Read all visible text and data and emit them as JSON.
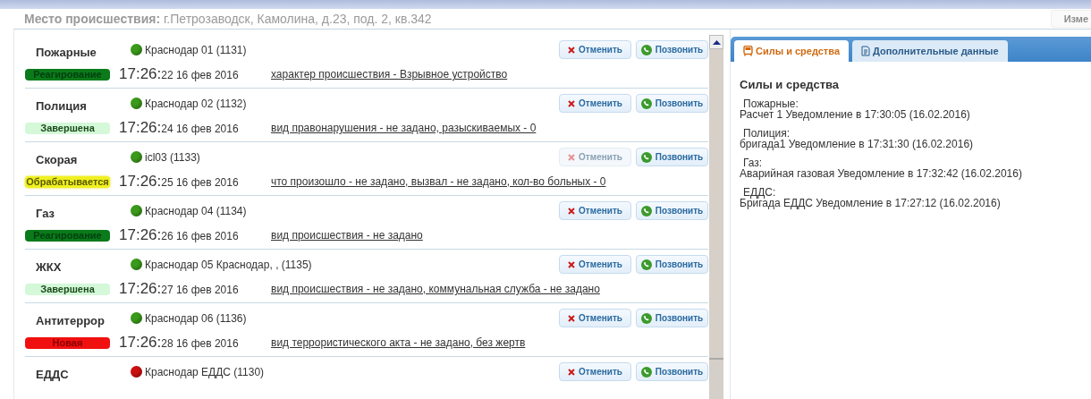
{
  "location": {
    "label": "Место происшествия:",
    "value": "г.Петрозаводск, Камолина, д.23, под. 2, кв.342"
  },
  "top_button": "Изме",
  "incidents": [
    {
      "service": "Пожарные",
      "unit": "Краснодар 01 (1131)",
      "dot": {
        "color": "#3a9a1a"
      },
      "status": {
        "kind": "reacting",
        "label": "Реагирование"
      },
      "time": "17:26:",
      "seconds_date": "22 16 фев 2016",
      "description": "характер происшествия - Взрывное устройство",
      "cancel": {
        "label": "Отменить",
        "disabled": false
      },
      "call": "Позвонить"
    },
    {
      "service": "Полиция",
      "unit": "Краснодар 02 (1132)",
      "dot": {
        "color": "#3a9a1a"
      },
      "status": {
        "kind": "done",
        "label": "Завершена"
      },
      "time": "17:26:",
      "seconds_date": "24 16 фев 2016",
      "description": "вид правонарушения - не задано, разыскиваемых - 0",
      "cancel": {
        "label": "Отменить",
        "disabled": false
      },
      "call": "Позвонить"
    },
    {
      "service": "Скорая",
      "unit": "icl03 (1133)",
      "dot": {
        "color": "#3a9a1a"
      },
      "status": {
        "kind": "processing",
        "label": "Обрабатывается"
      },
      "time": "17:26:",
      "seconds_date": "25 16 фев 2016",
      "description": "что произошло - не задано, вызвал - не задано, кол-во больных - 0",
      "cancel": {
        "label": "Отменить",
        "disabled": true
      },
      "call": "Позвонить"
    },
    {
      "service": "Газ",
      "unit": "Краснодар 04 (1134)",
      "dot": {
        "color": "#3a9a1a"
      },
      "status": {
        "kind": "reacting",
        "label": "Реагирование"
      },
      "time": "17:26:",
      "seconds_date": "26 16 фев 2016",
      "description": "вид происшествия - не задано",
      "cancel": {
        "label": "Отменить",
        "disabled": false
      },
      "call": "Позвонить"
    },
    {
      "service": "ЖКХ",
      "unit": "Краснодар 05 Краснодар, , (1135)",
      "dot": {
        "color": "#3a9a1a"
      },
      "status": {
        "kind": "done",
        "label": "Завершена"
      },
      "time": "17:26:",
      "seconds_date": "27 16 фев 2016",
      "description": "вид происшествия - не задано, коммунальная служба - не задано",
      "cancel": {
        "label": "Отменить",
        "disabled": false
      },
      "call": "Позвонить"
    },
    {
      "service": "Антитеррор",
      "unit": "Краснодар 06 (1136)",
      "dot": {
        "color": "#3a9a1a"
      },
      "status": {
        "kind": "new",
        "label": "Новая"
      },
      "time": "17:26:",
      "seconds_date": "28 16 фев 2016",
      "description": "вид террористического акта - не задано, без жертв",
      "cancel": {
        "label": "Отменить",
        "disabled": false
      },
      "call": "Позвонить"
    },
    {
      "service": "ЕДДС",
      "unit": "Краснодар ЕДДС (1130)",
      "dot": {
        "color": "#cc1111"
      },
      "cancel": {
        "label": "Отменить",
        "disabled": false
      },
      "call": "Позвонить"
    }
  ],
  "tabs": [
    {
      "label": "Силы и средства",
      "selected": true
    },
    {
      "label": "Дополнительные данные",
      "selected": false
    }
  ],
  "forces": {
    "title": "Силы и средства",
    "groups": [
      {
        "service": "Пожарные:",
        "detail": "Расчет 1 Уведомление в 17:30:05 (16.02.2016)"
      },
      {
        "service": "Полиция:",
        "detail": "бригада1 Уведомление в 17:31:30 (16.02.2016)"
      },
      {
        "service": "Газ:",
        "detail": "Аварийная газовая Уведомление в 17:32:42 (16.02.2016)"
      },
      {
        "service": "ЕДДС:",
        "detail": "Бригада ЕДДС Уведомление в 17:27:12 (16.02.2016)"
      }
    ]
  }
}
